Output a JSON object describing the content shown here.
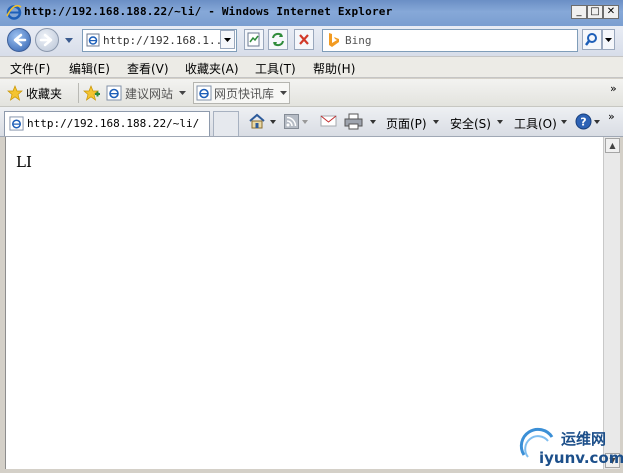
{
  "window": {
    "title": "http://192.168.188.22/~li/ - Windows Internet Explorer",
    "minimize": "_",
    "maximize": "□",
    "close": "✕"
  },
  "nav": {
    "address_text": "http://192.168.1...",
    "search_placeholder": "Bing",
    "search_button_icon": "search-icon"
  },
  "menu": {
    "items": [
      "文件(F)",
      "编辑(E)",
      "查看(V)",
      "收藏夹(A)",
      "工具(T)",
      "帮助(H)"
    ]
  },
  "favorites": {
    "label": "收藏夹",
    "suggested_sites": "建议网站",
    "web_slice_gallery": "网页快讯库"
  },
  "tabs": {
    "current_tab": "http://192.168.188.22/~li/"
  },
  "commands": {
    "page": "页面(P)",
    "safety": "安全(S)",
    "tools": "工具(O)"
  },
  "page": {
    "body_text": "LI"
  },
  "watermark": {
    "line1": "运维网",
    "line2": "iyunv.com"
  },
  "colors": {
    "title_bar": "#7a9ed0",
    "accent_blue": "#2e5fae",
    "close_red": "#d23a2a",
    "bing_orange": "#f29b22"
  }
}
